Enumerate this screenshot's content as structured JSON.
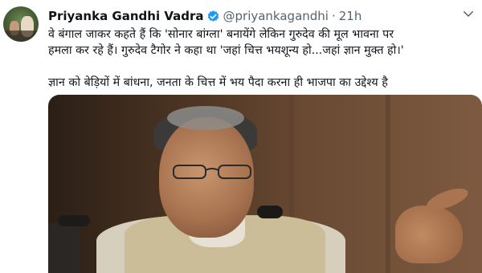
{
  "tweet": {
    "author_name": "Priyanka Gandhi Vadra",
    "handle": "@priyankagandhi",
    "separator": "·",
    "time": "21h",
    "lines": [
      "वे बंगाल जाकर कहते हैं कि 'सोनार बांग्ला' बनायेंगे लेकिन गुरुदेव की मूल भावना पर",
      "हमला कर रहे हैं। गुरुदेव टैगोर ने कहा था 'जहां चित्त भयशून्य हो...जहां ज्ञान मुक्त हो।'",
      "ज्ञान को बेड़ियों में बांधना, जनता के चित्त में भय पैदा करना ही भाजपा का उद्देश्य है"
    ]
  },
  "icons": {
    "verified": "verified-badge-icon",
    "more": "chevron-down-icon"
  },
  "colors": {
    "verified_blue": "#1d9bf0",
    "secondary_text": "#536471",
    "primary_text": "#0f1419"
  }
}
